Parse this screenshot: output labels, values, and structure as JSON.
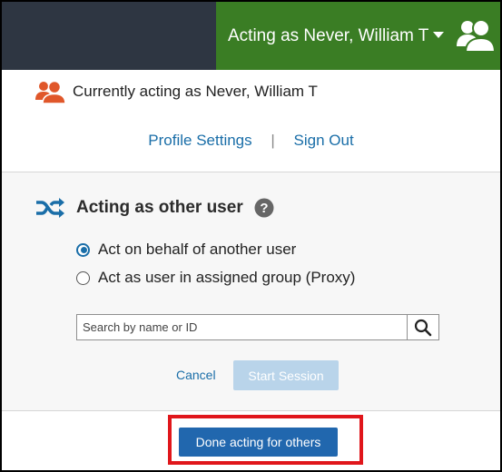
{
  "topbar": {
    "acting_label": "Acting as Never, William T",
    "caret_icon": "caret-down-icon",
    "avatar_icon": "users-icon"
  },
  "status": {
    "icon": "users-icon",
    "text": "Currently acting as Never, William T"
  },
  "links": {
    "profile_settings": "Profile Settings",
    "separator": "|",
    "sign_out": "Sign Out"
  },
  "acting_section": {
    "icon": "shuffle-icon",
    "title": "Acting as other user",
    "help_icon": "question-circle-icon",
    "options": [
      {
        "label": "Act on behalf of another user",
        "selected": true
      },
      {
        "label": "Act as user in assigned group (Proxy)",
        "selected": false
      }
    ],
    "search": {
      "placeholder": "Search by name or ID",
      "value": "",
      "icon": "search-icon"
    },
    "cancel_label": "Cancel",
    "start_label": "Start Session"
  },
  "done_label": "Done acting for others",
  "colors": {
    "header_dark": "#2e3642",
    "header_green": "#3a7d24",
    "link_blue": "#1a6ea8",
    "primary_button": "#2167ae",
    "disabled_button": "#b9d4ea",
    "user_icon_orange": "#e0572a",
    "highlight_red": "#e0161b"
  }
}
